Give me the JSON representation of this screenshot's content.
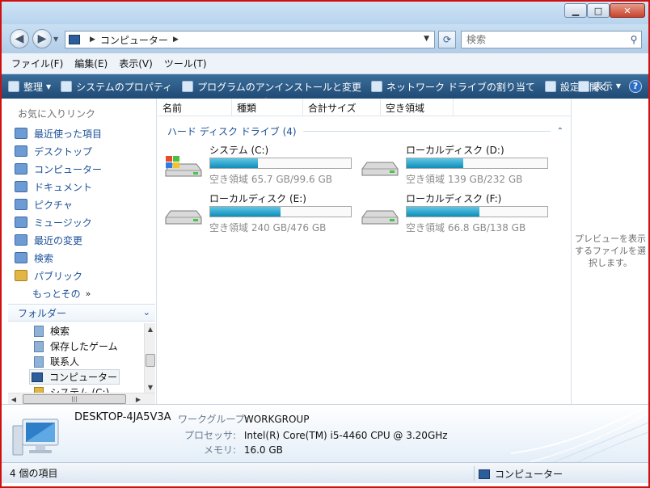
{
  "window": {
    "minimize_glyph": "▁",
    "maximize_glyph": "□",
    "close_glyph": "✕"
  },
  "address_bar": {
    "breadcrumb": "コンピューター",
    "search_placeholder": "検索",
    "refresh_glyph": "⟳"
  },
  "menu": {
    "items": [
      "ファイル(F)",
      "編集(E)",
      "表示(V)",
      "ツール(T)"
    ]
  },
  "command_bar": {
    "organize": "整理",
    "system_properties": "システムのプロパティ",
    "uninstall": "プログラムのアンインストールと変更",
    "map_drive": "ネットワーク ドライブの割り当て",
    "open_settings": "設定を開く",
    "views": "表示",
    "help_glyph": "?"
  },
  "nav": {
    "favorites_title": "お気に入りリンク",
    "favorites": [
      "最近使った項目",
      "デスクトップ",
      "コンピューター",
      "ドキュメント",
      "ピクチャ",
      "ミュージック",
      "最近の変更",
      "検索",
      "パブリック"
    ],
    "more": "もっとその",
    "more_chevron": "»",
    "folders_title": "フォルダー",
    "folders_chevron": "⌄",
    "tree": [
      "検索",
      "保存したゲーム",
      "联系人",
      "コンピューター",
      "システム (C:)"
    ]
  },
  "columns": {
    "name": "名前",
    "type": "種類",
    "total_size": "合計サイズ",
    "free_space": "空き領域"
  },
  "group": {
    "title": "ハード ディスク ドライブ (4)",
    "collapse_glyph": "⌃"
  },
  "drives": [
    {
      "name": "システム (C:)",
      "info": "空き領域 65.7 GB/99.6 GB",
      "used_fraction": 0.34
    },
    {
      "name": "ローカルディスク (D:)",
      "info": "空き領域 139 GB/232 GB",
      "used_fraction": 0.4
    },
    {
      "name": "ローカルディスク (E:)",
      "info": "空き領域 240 GB/476 GB",
      "used_fraction": 0.5
    },
    {
      "name": "ローカルディスク (F:)",
      "info": "空き領域 66.8 GB/138 GB",
      "used_fraction": 0.52
    }
  ],
  "preview": {
    "message": "プレビューを表示するファイルを選択します。"
  },
  "details": {
    "computer_name": "DESKTOP-4JA5V3A",
    "workgroup_label": "ワークグループ:",
    "workgroup_value": "WORKGROUP",
    "processor_label": "プロセッサ:",
    "processor_value": "Intel(R) Core(TM) i5-4460  CPU @ 3.20GHz",
    "memory_label": "メモリ:",
    "memory_value": "16.0 GB"
  },
  "status": {
    "item_count": "4 個の項目",
    "location": "コンピューター"
  },
  "colors": {
    "accent": "#1a4f97",
    "command_bar": "#2b5a87",
    "drive_fill": "#1b9ac4"
  }
}
